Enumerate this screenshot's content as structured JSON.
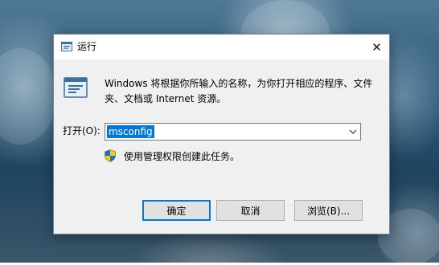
{
  "dialog": {
    "title": "运行",
    "close_glyph": "✕",
    "description": "Windows 将根据你所输入的名称，为你打开相应的程序、文件夹、文档或 Internet 资源。",
    "open_label": "打开(O):",
    "command_value": "msconfig",
    "admin_note": "使用管理权限创建此任务。",
    "buttons": {
      "ok": "确定",
      "cancel": "取消",
      "browse": "浏览(B)..."
    }
  },
  "icons": {
    "title": "run-app-icon",
    "main": "run-app-icon",
    "shield": "uac-shield-icon",
    "dropdown": "chevron-down-icon",
    "close": "close-icon"
  },
  "colors": {
    "selection": "#0078d7",
    "default_button_border": "#0078d7"
  }
}
